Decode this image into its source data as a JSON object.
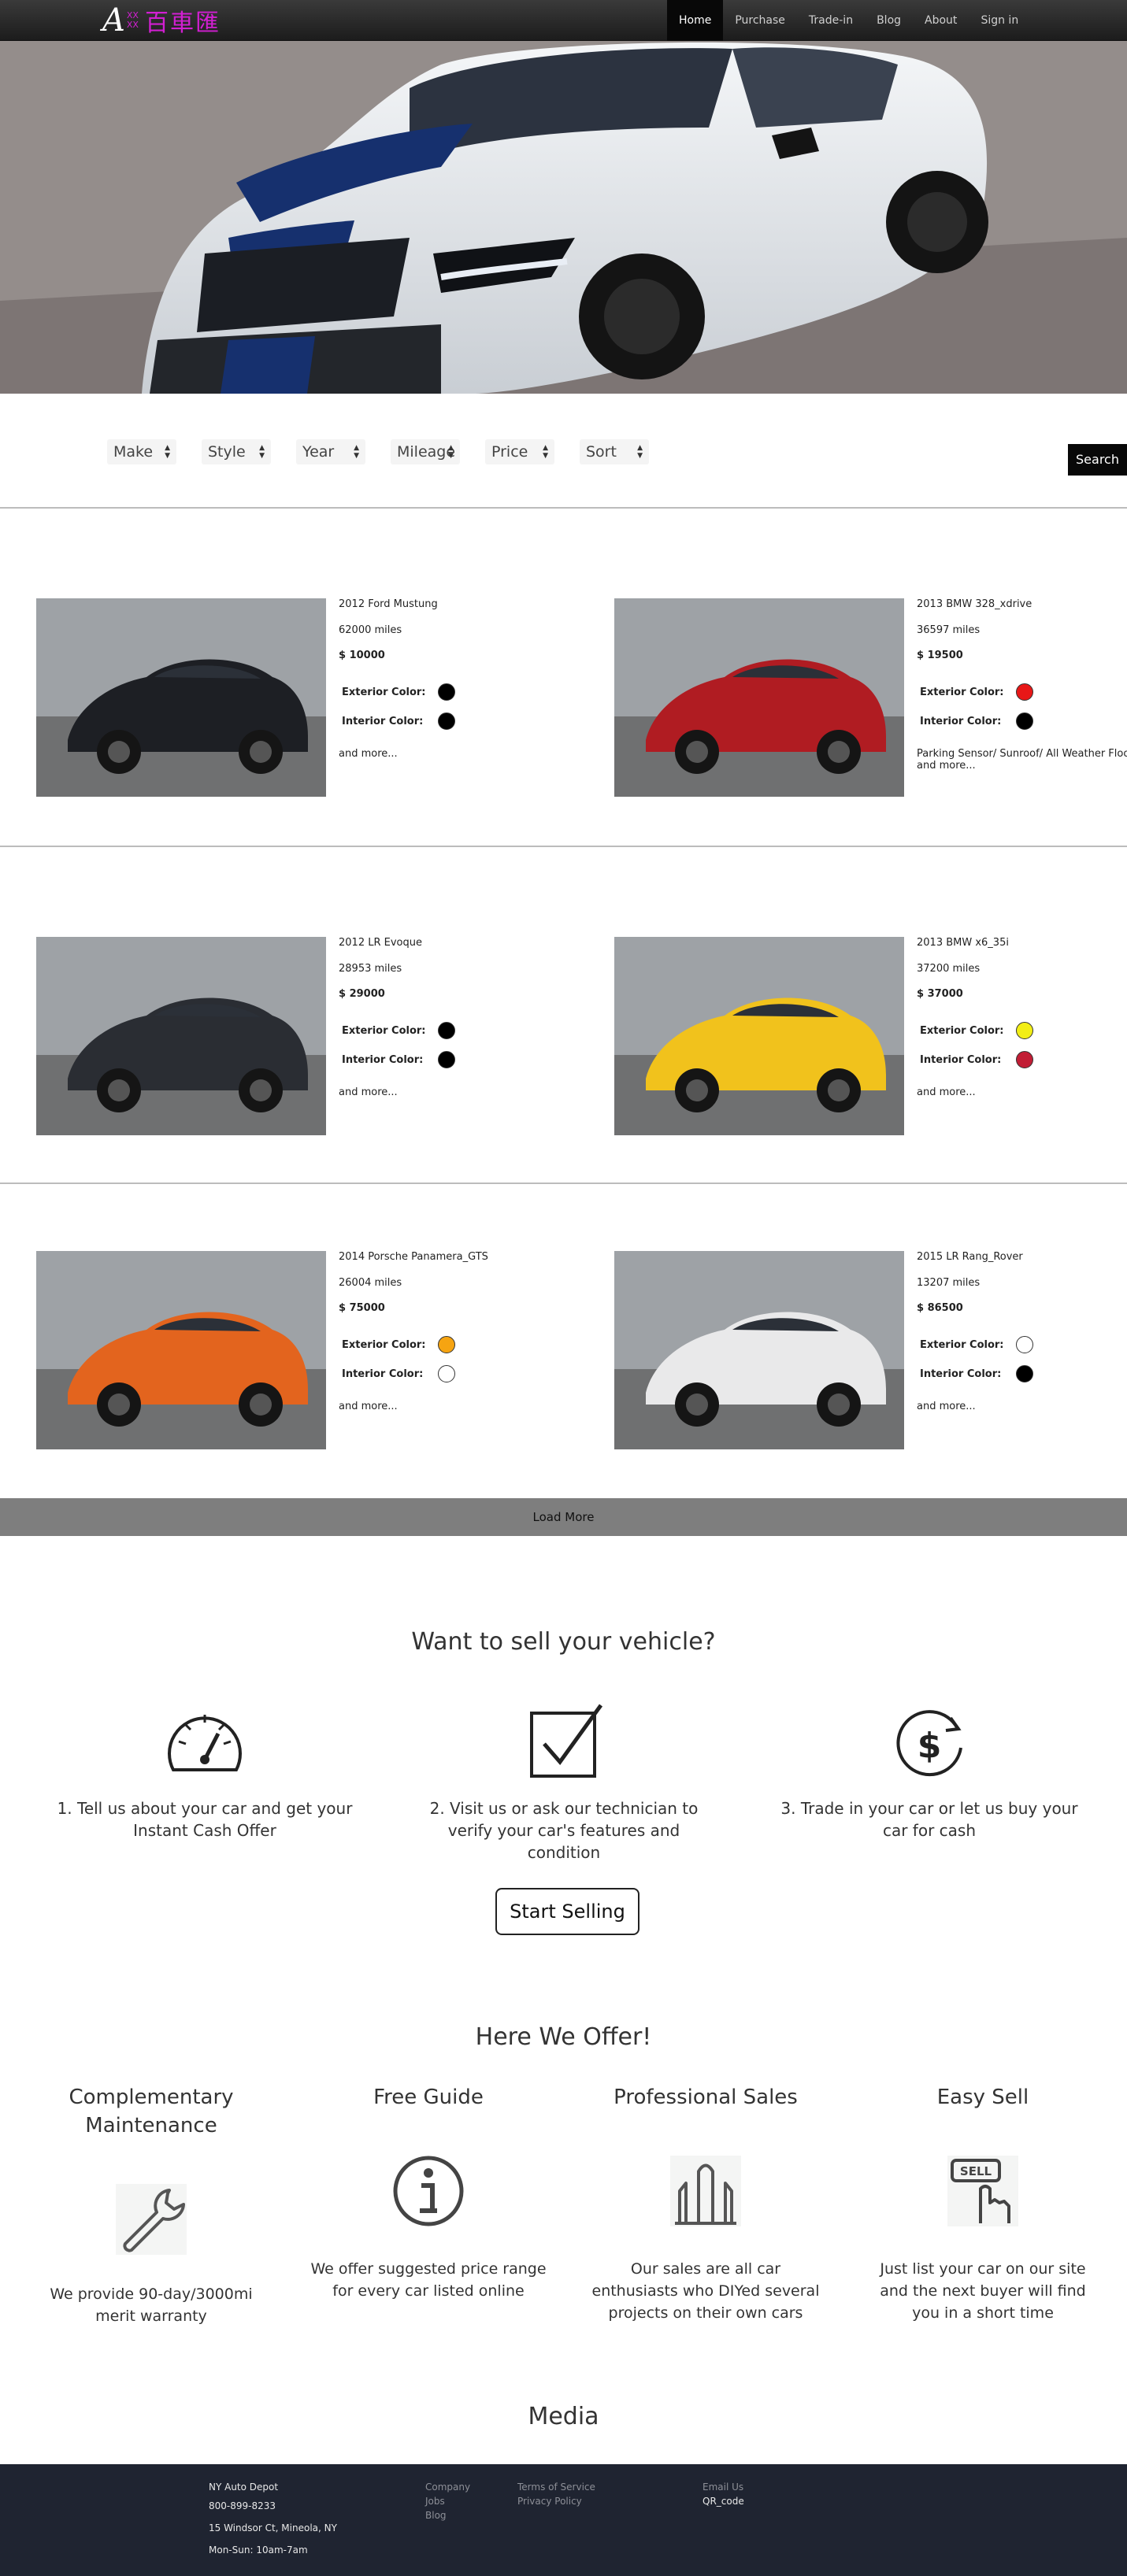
{
  "nav": {
    "logo_letter": "A",
    "logo_sub_top": "XX",
    "logo_sub_bottom": "XX",
    "logo_cn": "百車匯",
    "items": [
      {
        "label": "Home"
      },
      {
        "label": "Purchase"
      },
      {
        "label": "Trade-in"
      },
      {
        "label": "Blog"
      },
      {
        "label": "About"
      },
      {
        "label": "Sign in"
      }
    ]
  },
  "filters": [
    {
      "label": "Make"
    },
    {
      "label": "Style"
    },
    {
      "label": "Year"
    },
    {
      "label": "Mileage"
    },
    {
      "label": "Price"
    },
    {
      "label": "Sort"
    }
  ],
  "search_label": "Search",
  "labels": {
    "exterior": "Exterior Color:",
    "interior": "Interior Color:",
    "more": "and more..."
  },
  "cars": [
    {
      "title": "2012 Ford Mustung",
      "miles": "62000 miles",
      "price": "$ 10000",
      "exterior": "#000000",
      "interior": "#000000",
      "extra": "",
      "body": "#1d1f24"
    },
    {
      "title": "2013 BMW 328_xdrive",
      "miles": "36597 miles",
      "price": "$ 19500",
      "exterior": "#e81717",
      "interior": "#000000",
      "extra": "Parking Sensor/ Sunroof/ All Weather Floor Mats/ and more...",
      "body": "#b01c22"
    },
    {
      "title": "2012 LR Evoque",
      "miles": "28953 miles",
      "price": "$ 29000",
      "exterior": "#000000",
      "interior": "#000000",
      "extra": "",
      "body": "#2a2d33"
    },
    {
      "title": "2013 BMW x6_35i",
      "miles": "37200 miles",
      "price": "$ 37000",
      "exterior": "#f2ee16",
      "interior": "#c21d35",
      "extra": "",
      "body": "#f1c21c"
    },
    {
      "title": "2014 Porsche Panamera_GTS",
      "miles": "26004 miles",
      "price": "$ 75000",
      "exterior": "#f6a411",
      "interior": "#ffffff",
      "extra": "",
      "body": "#e3641e"
    },
    {
      "title": "2015 LR Rang_Rover",
      "miles": "13207 miles",
      "price": "$ 86500",
      "exterior": "#ffffff",
      "interior": "#000000",
      "extra": "",
      "body": "#e9e9ea"
    }
  ],
  "load_more": "Load More",
  "sell": {
    "title": "Want to sell your vehicle?",
    "steps": [
      {
        "icon": "speedometer-icon",
        "text": "1. Tell us about your car and get your Instant Cash Offer"
      },
      {
        "icon": "checkbox-icon",
        "text": "2. Visit us or ask our technician to verify your car's features and condition"
      },
      {
        "icon": "dollar-refresh-icon",
        "text": "3. Trade in your car or let us buy your car for cash"
      }
    ],
    "button": "Start Selling"
  },
  "offer": {
    "title": "Here We Offer!",
    "items": [
      {
        "icon": "wrench-icon",
        "title": "Complementary Maintenance",
        "text": "We provide 90-day/3000mi merit warranty"
      },
      {
        "icon": "info-icon",
        "title": "Free Guide",
        "text": "We offer suggested price range for every car listed online"
      },
      {
        "icon": "sales-hands-icon",
        "title": "Professional Sales",
        "text": "Our sales are all car enthusiasts who DIYed several projects on their own cars"
      },
      {
        "icon": "sell-sign-icon",
        "title": "Easy Sell",
        "text": "Just list your car on our site and the next buyer will find you in a short time"
      }
    ]
  },
  "media_title": "Media",
  "footer": {
    "name": "NY Auto Depot",
    "phone": "800-899-8233",
    "address": "15 Windsor Ct, Mineola, NY",
    "hours": "Mon-Sun: 10am-7am",
    "company": "Company",
    "jobs": "Jobs",
    "blog": "Blog",
    "terms": "Terms of Service",
    "privacy": "Privacy Policy",
    "email": "Email Us",
    "qr": "QR_code"
  },
  "colors": {
    "nav_bg": "#1c1c1c",
    "logo_accent": "#d21fd2",
    "footer_bg": "#1f2431",
    "load_more_bg": "#7e7e7e"
  }
}
